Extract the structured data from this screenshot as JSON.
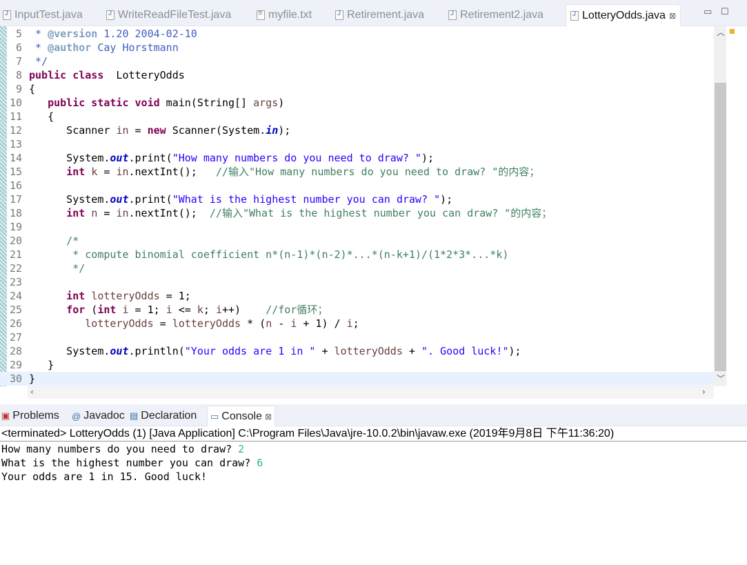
{
  "editor_tabs": [
    {
      "label": "InputTest.java",
      "icon": "java-file-icon"
    },
    {
      "label": "WriteReadFileTest.java",
      "icon": "java-file-icon"
    },
    {
      "label": "myfile.txt",
      "icon": "text-file-icon"
    },
    {
      "label": "Retirement.java",
      "icon": "java-file-icon"
    },
    {
      "label": "Retirement2.java",
      "icon": "java-file-icon"
    },
    {
      "label": "LotteryOdds.java",
      "icon": "java-file-icon",
      "active": true,
      "close": "⊠"
    }
  ],
  "code_lines": [
    {
      "n": "5",
      "seg": [
        [
          "jd",
          " * "
        ],
        [
          "jt",
          "@version"
        ],
        [
          "jd",
          " 1.20 2004-02-10"
        ]
      ]
    },
    {
      "n": "6",
      "seg": [
        [
          "jd",
          " * "
        ],
        [
          "jt",
          "@author"
        ],
        [
          "jd",
          " Cay Horstmann"
        ]
      ]
    },
    {
      "n": "7",
      "seg": [
        [
          "jd",
          " */"
        ]
      ]
    },
    {
      "n": "8",
      "seg": [
        [
          "kw",
          "public class"
        ],
        [
          "",
          "  LotteryOdds"
        ]
      ]
    },
    {
      "n": "9",
      "seg": [
        [
          "",
          "{"
        ]
      ]
    },
    {
      "n": "10",
      "seg": [
        [
          "",
          "   "
        ],
        [
          "kw",
          "public static void"
        ],
        [
          "",
          " main(String[] "
        ],
        [
          "var",
          "args"
        ],
        [
          "",
          ")"
        ]
      ]
    },
    {
      "n": "11",
      "seg": [
        [
          "",
          "   {"
        ]
      ]
    },
    {
      "n": "12",
      "seg": [
        [
          "",
          "      Scanner "
        ],
        [
          "var",
          "in"
        ],
        [
          "",
          " = "
        ],
        [
          "kw",
          "new"
        ],
        [
          "",
          " Scanner(System."
        ],
        [
          "fld",
          "in"
        ],
        [
          "",
          ");"
        ]
      ]
    },
    {
      "n": "13",
      "seg": []
    },
    {
      "n": "14",
      "seg": [
        [
          "",
          "      System."
        ],
        [
          "fld",
          "out"
        ],
        [
          "",
          ".print("
        ],
        [
          "str",
          "\"How many numbers do you need to draw? \""
        ],
        [
          "",
          ");"
        ]
      ]
    },
    {
      "n": "15",
      "seg": [
        [
          "",
          "      "
        ],
        [
          "kw",
          "int"
        ],
        [
          "",
          " "
        ],
        [
          "var",
          "k"
        ],
        [
          "",
          " = "
        ],
        [
          "var",
          "in"
        ],
        [
          "",
          ".nextInt();   "
        ],
        [
          "cm",
          "//输入\"How many numbers do you need to draw? \"的内容；"
        ]
      ]
    },
    {
      "n": "16",
      "seg": []
    },
    {
      "n": "17",
      "seg": [
        [
          "",
          "      System."
        ],
        [
          "fld",
          "out"
        ],
        [
          "",
          ".print("
        ],
        [
          "str",
          "\"What is the highest number you can draw? \""
        ],
        [
          "",
          ");"
        ]
      ]
    },
    {
      "n": "18",
      "seg": [
        [
          "",
          "      "
        ],
        [
          "kw",
          "int"
        ],
        [
          "",
          " "
        ],
        [
          "var",
          "n"
        ],
        [
          "",
          " = "
        ],
        [
          "var",
          "in"
        ],
        [
          "",
          ".nextInt();  "
        ],
        [
          "cm",
          "//输入\"What is the highest number you can draw? \"的内容；"
        ]
      ]
    },
    {
      "n": "19",
      "seg": []
    },
    {
      "n": "20",
      "seg": [
        [
          "cm",
          "      /*"
        ]
      ]
    },
    {
      "n": "21",
      "seg": [
        [
          "cm",
          "       * compute binomial coefficient n*(n-1)*(n-2)*...*(n-k+1)/(1*2*3*...*k)"
        ]
      ]
    },
    {
      "n": "22",
      "seg": [
        [
          "cm",
          "       */"
        ]
      ]
    },
    {
      "n": "23",
      "seg": []
    },
    {
      "n": "24",
      "seg": [
        [
          "",
          "      "
        ],
        [
          "kw",
          "int"
        ],
        [
          "",
          " "
        ],
        [
          "var",
          "lotteryOdds"
        ],
        [
          "",
          " = 1;"
        ]
      ]
    },
    {
      "n": "25",
      "seg": [
        [
          "",
          "      "
        ],
        [
          "kw",
          "for"
        ],
        [
          "",
          " ("
        ],
        [
          "kw",
          "int"
        ],
        [
          "",
          " "
        ],
        [
          "var",
          "i"
        ],
        [
          "",
          " = 1; "
        ],
        [
          "var",
          "i"
        ],
        [
          "",
          " <= "
        ],
        [
          "var",
          "k"
        ],
        [
          "",
          "; "
        ],
        [
          "var",
          "i"
        ],
        [
          "",
          "++)    "
        ],
        [
          "cm",
          "//for循环；"
        ]
      ]
    },
    {
      "n": "26",
      "seg": [
        [
          "",
          "         "
        ],
        [
          "var",
          "lotteryOdds"
        ],
        [
          "",
          " = "
        ],
        [
          "var",
          "lotteryOdds"
        ],
        [
          "",
          " * ("
        ],
        [
          "var",
          "n"
        ],
        [
          "",
          " - "
        ],
        [
          "var",
          "i"
        ],
        [
          "",
          " + 1) / "
        ],
        [
          "var",
          "i"
        ],
        [
          "",
          ";"
        ]
      ]
    },
    {
      "n": "27",
      "seg": []
    },
    {
      "n": "28",
      "seg": [
        [
          "",
          "      System."
        ],
        [
          "fld",
          "out"
        ],
        [
          "",
          ".println("
        ],
        [
          "str",
          "\"Your odds are 1 in \""
        ],
        [
          "",
          " + "
        ],
        [
          "var",
          "lotteryOdds"
        ],
        [
          "",
          " + "
        ],
        [
          "str",
          "\". Good luck!\""
        ],
        [
          "",
          ");"
        ]
      ]
    },
    {
      "n": "29",
      "seg": [
        [
          "",
          "   }"
        ]
      ]
    },
    {
      "n": "30",
      "seg": [
        [
          "",
          "}"
        ]
      ],
      "current": true
    }
  ],
  "panel_tabs": [
    {
      "label": "Problems",
      "icon": "problems-icon"
    },
    {
      "label": "Javadoc",
      "icon": "at-icon"
    },
    {
      "label": "Declaration",
      "icon": "declaration-icon"
    },
    {
      "label": "Console",
      "icon": "console-icon",
      "active": true,
      "close": "⊠"
    }
  ],
  "console": {
    "header": "<terminated> LotteryOdds (1) [Java Application] C:\\Program Files\\Java\\jre-10.0.2\\bin\\javaw.exe (2019年9月8日 下午11:36:20)",
    "lines": [
      {
        "prompt": "How many numbers do you need to draw? ",
        "input": "2"
      },
      {
        "prompt": "What is the highest number you can draw? ",
        "input": "6"
      },
      {
        "prompt": "Your odds are 1 in 15. Good luck!",
        "input": ""
      }
    ]
  }
}
